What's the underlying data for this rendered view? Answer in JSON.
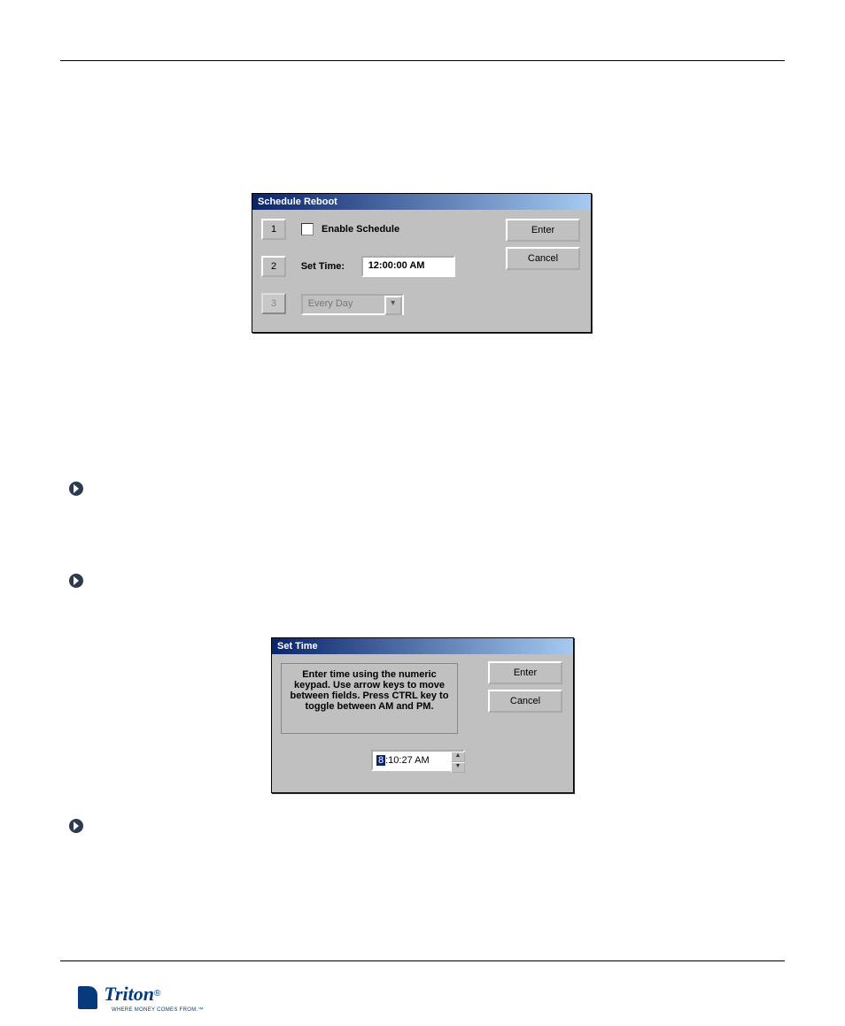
{
  "dialog1": {
    "title": "Schedule Reboot",
    "btn_num_1": "1",
    "btn_num_2": "2",
    "btn_num_3": "3",
    "enable_label": "Enable Schedule",
    "set_time_label": "Set Time:",
    "time_value": "12:00:00 AM",
    "frequency_value": "Every Day",
    "enter_label": "Enter",
    "cancel_label": "Cancel"
  },
  "dialog2": {
    "title": "Set Time",
    "message": "Enter time using the numeric keypad.  Use arrow keys to move between fields.  Press CTRL key to toggle between AM and PM.",
    "time_selected_segment": "8",
    "time_rest": ":10:27 AM",
    "enter_label": "Enter",
    "cancel_label": "Cancel"
  },
  "footer": {
    "brand": "Triton",
    "tagline": "WHERE MONEY COMES FROM.™"
  }
}
